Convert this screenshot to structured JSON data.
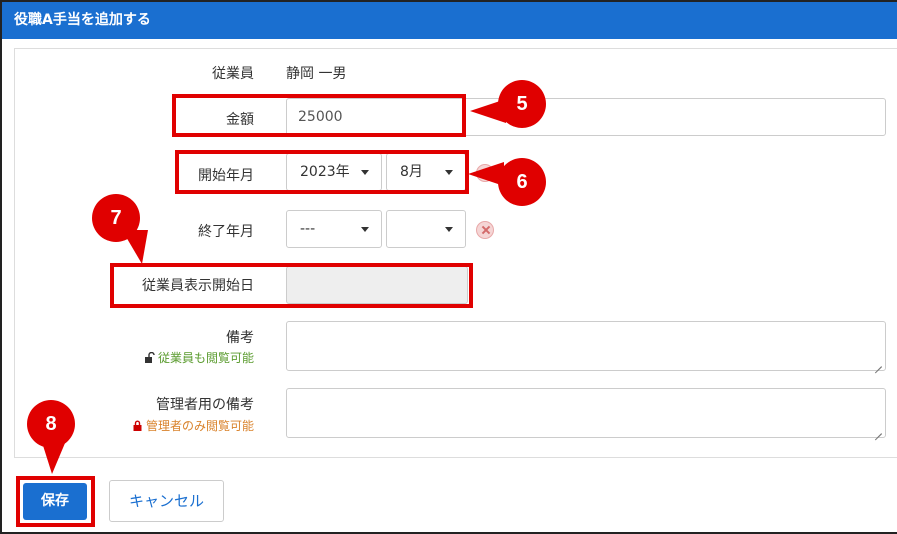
{
  "modal": {
    "title": "役職A手当を追加する"
  },
  "form": {
    "employee": {
      "label": "従業員",
      "value": "静岡 一男"
    },
    "amount": {
      "label": "金額",
      "value": "25000"
    },
    "start": {
      "label": "開始年月",
      "year": "2023年",
      "month": "8月"
    },
    "end": {
      "label": "終了年月",
      "year": "---",
      "month": ""
    },
    "display_start": {
      "label": "従業員表示開始日",
      "value": ""
    },
    "remarks": {
      "label": "備考",
      "note": "従業員も閲覧可能",
      "icon": "unlock-icon",
      "note_color": "#5a9b2e"
    },
    "admin_remarks": {
      "label": "管理者用の備考",
      "note": "管理者のみ閲覧可能",
      "icon": "lock-icon",
      "note_color": "#d9822b"
    }
  },
  "buttons": {
    "save": "保存",
    "cancel": "キャンセル"
  },
  "annotations": {
    "c5": "5",
    "c6": "6",
    "c7": "7",
    "c8": "8"
  },
  "colors": {
    "header": "#1a6fd0",
    "annotation": "#e00000"
  }
}
